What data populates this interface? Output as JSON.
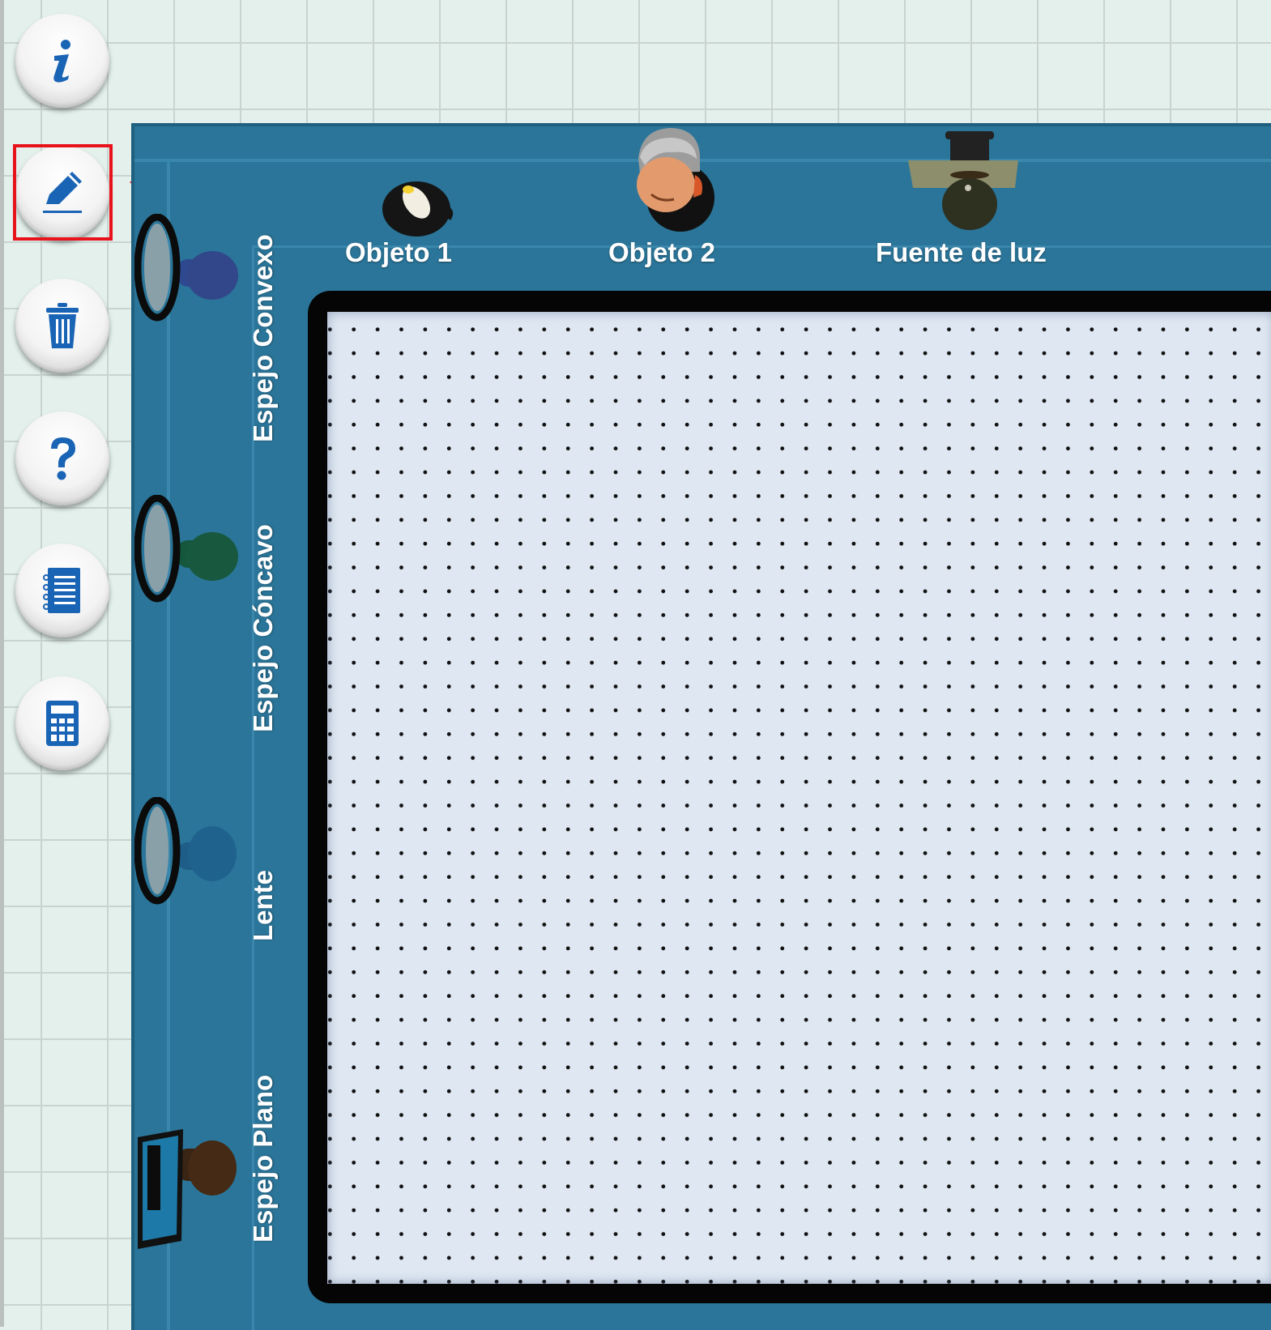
{
  "toolbar": {
    "buttons": [
      {
        "id": "info",
        "icon": "info-icon"
      },
      {
        "id": "edit",
        "icon": "pencil-icon",
        "highlighted": true
      },
      {
        "id": "delete",
        "icon": "trash-icon"
      },
      {
        "id": "help",
        "icon": "question-icon"
      },
      {
        "id": "notes",
        "icon": "checklist-icon"
      },
      {
        "id": "calculator",
        "icon": "calculator-icon"
      }
    ],
    "accent_color": "#1a64b5",
    "highlight_color": "#e8121b"
  },
  "palette": {
    "top_items": [
      {
        "label": "Objeto 1",
        "icon": "candle-icon"
      },
      {
        "label": "Objeto 2",
        "icon": "person-head-icon"
      },
      {
        "label": "Fuente de luz",
        "icon": "flashlight-icon"
      }
    ],
    "side_items": [
      {
        "label": "Espejo Convexo",
        "icon": "convex-mirror-icon"
      },
      {
        "label": "Espejo Cóncavo",
        "icon": "concave-mirror-icon"
      },
      {
        "label": "Lente",
        "icon": "lens-icon"
      },
      {
        "label": "Espejo Plano",
        "icon": "plane-mirror-icon"
      }
    ]
  },
  "colors": {
    "panel": "#2a7599",
    "board_frame": "#050505",
    "board_surface": "#dfe8f2",
    "background_grid": "#e3f0ec"
  }
}
